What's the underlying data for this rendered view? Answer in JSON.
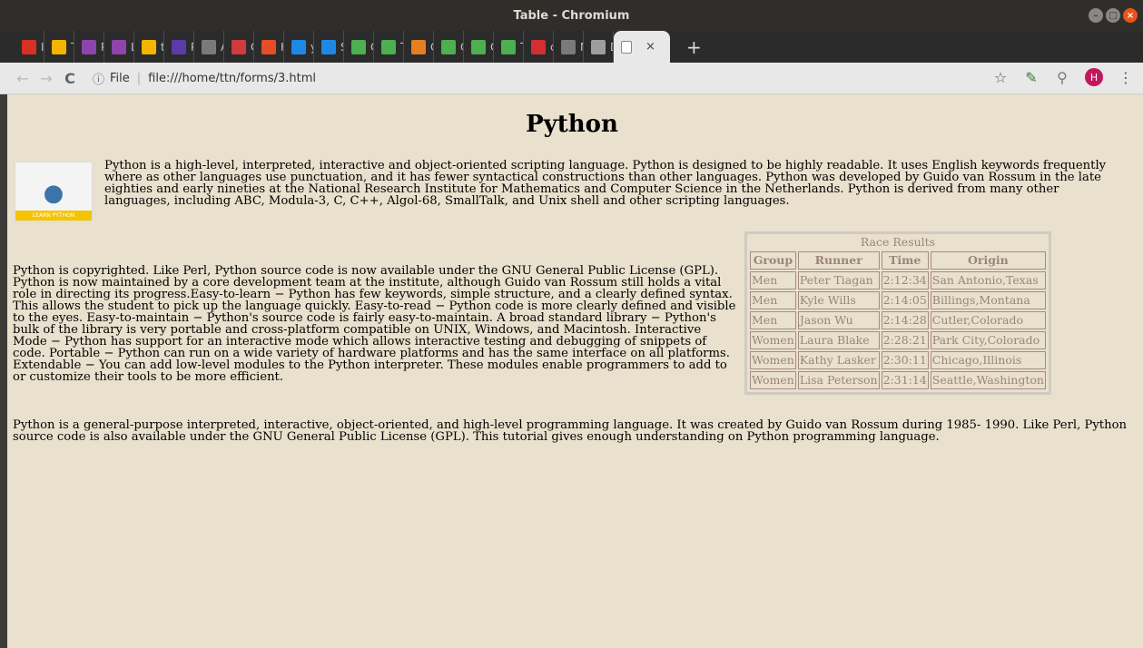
{
  "window": {
    "title": "Table - Chromium"
  },
  "tabs": [
    {
      "label": "Inl",
      "icon": "gmail-icon",
      "color": "#d93025"
    },
    {
      "label": "Tal",
      "icon": "doc-icon",
      "color": "#f4b400"
    },
    {
      "label": "Pr",
      "icon": "circle-icon",
      "color": "#8e44ad"
    },
    {
      "label": "Le",
      "icon": "circle-icon",
      "color": "#8e44ad"
    },
    {
      "label": "te",
      "icon": "doc-icon",
      "color": "#f4b400"
    },
    {
      "label": "PS",
      "icon": "circle-icon",
      "color": "#5b3ba8"
    },
    {
      "label": "AA",
      "icon": "page-icon",
      "color": "#7a7a7a"
    },
    {
      "label": "Co",
      "icon": "co-icon",
      "color": "#d13b3b"
    },
    {
      "label": "HT",
      "icon": "square-icon",
      "color": "#e44d26"
    },
    {
      "label": "yo",
      "icon": "flag-icon",
      "color": "#1e88e5"
    },
    {
      "label": "Sta",
      "icon": "flag-icon",
      "color": "#1e88e5"
    },
    {
      "label": "CS",
      "icon": "w3-icon",
      "color": "#4caf50"
    },
    {
      "label": "Try",
      "icon": "w3-icon",
      "color": "#4caf50"
    },
    {
      "label": "Gr",
      "icon": "circle-icon",
      "color": "#e67e22"
    },
    {
      "label": "CS",
      "icon": "w3-icon",
      "color": "#4caf50"
    },
    {
      "label": "CS",
      "icon": "w3-icon",
      "color": "#4caf50"
    },
    {
      "label": "Try",
      "icon": "w3-icon",
      "color": "#4caf50"
    },
    {
      "label": "css",
      "icon": "mountain-icon",
      "color": "#d32f2f"
    },
    {
      "label": "Ne",
      "icon": "page-icon",
      "color": "#7a7a7a"
    },
    {
      "label": "Di",
      "icon": "gear-icon",
      "color": "#9e9e9e"
    }
  ],
  "active_tab": {
    "close": "×"
  },
  "new_tab": "+",
  "toolbar": {
    "back": "←",
    "forward": "→",
    "reload": "C",
    "info": "ⓘ",
    "scheme": "File",
    "url": "file:///home/ttn/forms/3.html",
    "star": "☆",
    "avatar": "H",
    "menu": "⋮"
  },
  "page": {
    "heading": "Python",
    "logo_text": "LEARN PYTHON",
    "para1": "Python is a high-level, interpreted, interactive and object-oriented scripting language. Python is designed to be highly readable. It uses English keywords frequently where as other languages use punctuation, and it has fewer syntactical constructions than other languages. Python was developed by Guido van Rossum in the late eighties and early nineties at the National Research Institute for Mathematics and Computer Science in the Netherlands. Python is derived from many other languages, including ABC, Modula-3, C, C++, Algol-68, SmallTalk, and Unix shell and other scripting languages.",
    "para2": "Python is copyrighted. Like Perl, Python source code is now available under the GNU General Public License (GPL). Python is now maintained by a core development team at the institute, although Guido van Rossum still holds a vital role in directing its progress.Easy-to-learn − Python has few keywords, simple structure, and a clearly defined syntax. This allows the student to pick up the language quickly. Easy-to-read − Python code is more clearly defined and visible to the eyes. Easy-to-maintain − Python's source code is fairly easy-to-maintain. A broad standard library − Python's bulk of the library is very portable and cross-platform compatible on UNIX, Windows, and Macintosh. Interactive Mode − Python has support for an interactive mode which allows interactive testing and debugging of snippets of code. Portable − Python can run on a wide variety of hardware platforms and has the same interface on all platforms. Extendable − You can add low-level modules to the Python interpreter. These modules enable programmers to add to or customize their tools to be more efficient.",
    "para3": "Python is a general-purpose interpreted, interactive, object-oriented, and high-level programming language. It was created by Guido van Rossum during 1985- 1990. Like Perl, Python source code is also available under the GNU General Public License (GPL). This tutorial gives enough understanding on Python programming language.",
    "race": {
      "caption": "Race Results",
      "headers": [
        "Group",
        "Runner",
        "Time",
        "Origin"
      ],
      "rows": [
        [
          "Men",
          "Peter Tiagan",
          "2:12:34",
          "San Antonio,Texas"
        ],
        [
          "Men",
          "Kyle Wills",
          "2:14:05",
          "Billings,Montana"
        ],
        [
          "Men",
          "Jason Wu",
          "2:14:28",
          "Cutler,Colorado"
        ],
        [
          "Women",
          "Laura Blake",
          "2:28:21",
          "Park City,Colorado"
        ],
        [
          "Women",
          "Kathy Lasker",
          "2:30:11",
          "Chicago,Illinois"
        ],
        [
          "Women",
          "Lisa Peterson",
          "2:31:14",
          "Seattle,Washington"
        ]
      ]
    }
  }
}
